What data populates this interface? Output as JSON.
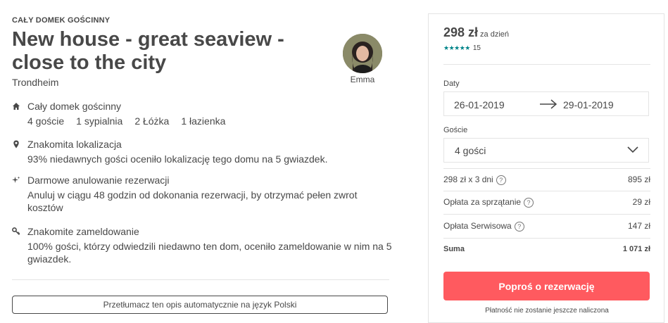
{
  "listing": {
    "eyebrow": "CAŁY DOMEK GOŚCINNY",
    "title": "New house - great seaview - close to the city",
    "city": "Trondheim",
    "host_name": "Emma"
  },
  "features": [
    {
      "icon": "home-icon",
      "head": "Cały domek gościnny",
      "specs": [
        "4 goście",
        "1 sypialnia",
        "2 Łóżka",
        "1 łazienka"
      ]
    },
    {
      "icon": "location-pin-icon",
      "head": "Znakomita lokalizacja",
      "body": "93% niedawnych gości oceniło lokalizację tego domu na 5 gwiazdek."
    },
    {
      "icon": "sparkle-icon",
      "head": "Darmowe anulowanie rezerwacji",
      "body": "Anuluj w ciągu 48 godzin od dokonania rezerwacji, by otrzymać pełen zwrot kosztów"
    },
    {
      "icon": "key-icon",
      "head": "Znakomite zameldowanie",
      "body": "100% gości, którzy odwiedzili niedawno ten dom, oceniło zameldowanie w nim na 5 gwiazdek."
    }
  ],
  "translate_button": "Przetłumacz ten opis automatycznie na język Polski",
  "booking": {
    "price": "298 zł",
    "per": "za dzień",
    "stars": "★★★★★",
    "rating": 5,
    "review_count": "15",
    "dates_label": "Daty",
    "check_in": "26-01-2019",
    "check_out": "29-01-2019",
    "guests_label": "Goście",
    "guests_value": "4 gości",
    "rows": [
      {
        "label": "298 zł x 3 dni",
        "value": "895 zł"
      },
      {
        "label": "Opłata za sprzątanie",
        "value": "29 zł"
      },
      {
        "label": "Opłata Serwisowa",
        "value": "147 zł"
      }
    ],
    "total_label": "Suma",
    "total_value": "1 071 zł",
    "reserve_button": "Poproś o rezerwację",
    "note": "Płatność nie zostanie jeszcze naliczona",
    "accent_color": "#ff5a5f",
    "star_color": "#008489"
  }
}
